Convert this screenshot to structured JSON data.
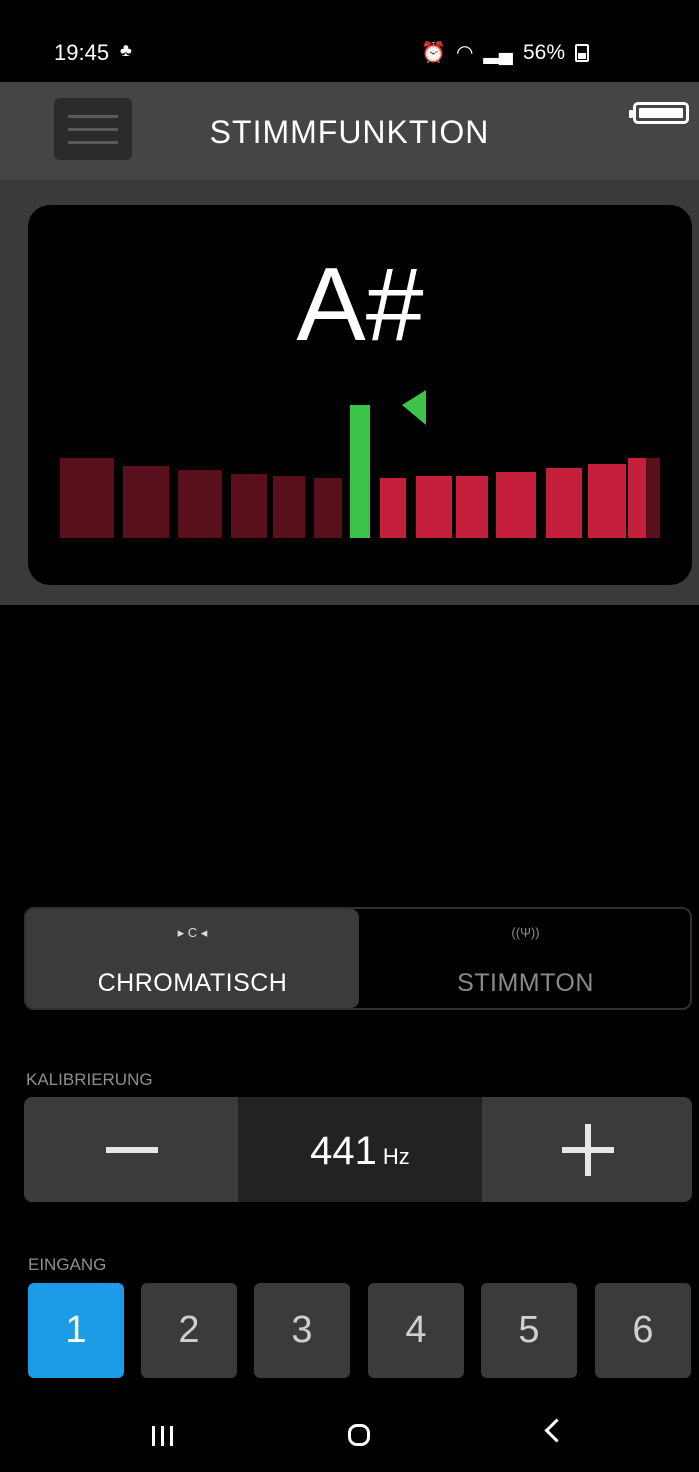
{
  "status_bar": {
    "time": "19:45",
    "battery_pct": "56%"
  },
  "app_bar": {
    "title": "STIMMFUNKTION"
  },
  "tuner": {
    "note": "A#",
    "colors": {
      "in_tune": "#3cc44a",
      "segment": "#c41f3b",
      "segment_dim": "#5a0f1c"
    }
  },
  "mode": {
    "options": [
      {
        "label": "CHROMATISCH",
        "icon": "chromatic-icon",
        "icon_text": "▸ C ◂",
        "selected": true
      },
      {
        "label": "STIMMTON",
        "icon": "tuning-fork-icon",
        "icon_text": "((Ψ))",
        "selected": false
      }
    ]
  },
  "calibration": {
    "label": "KALIBRIERUNG",
    "value": "441",
    "unit": "Hz"
  },
  "input": {
    "label": "EINGANG",
    "channels": [
      "1",
      "2",
      "3",
      "4",
      "5",
      "6"
    ],
    "selected": "1",
    "active_color": "#1c9be6"
  }
}
